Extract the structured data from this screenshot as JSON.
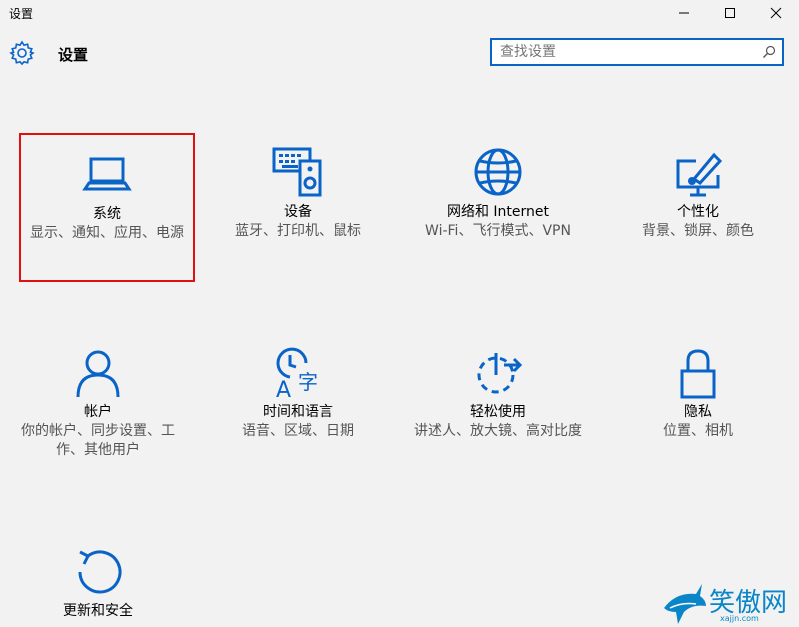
{
  "window": {
    "title": "设置"
  },
  "header": {
    "title": "设置",
    "gear_icon": "gear-icon"
  },
  "search": {
    "placeholder": "查找设置",
    "icon": "search-icon"
  },
  "colors": {
    "accent": "#0a64c8",
    "selection_border": "#e01010",
    "background": "#f2f2f2"
  },
  "tiles": [
    {
      "name": "系统",
      "desc": "显示、通知、应用、电源",
      "icon": "laptop-icon",
      "selected": true
    },
    {
      "name": "设备",
      "desc": "蓝牙、打印机、鼠标",
      "icon": "keyboard-speaker-icon"
    },
    {
      "name": "网络和 Internet",
      "desc": "Wi-Fi、飞行模式、VPN",
      "icon": "globe-icon"
    },
    {
      "name": "个性化",
      "desc": "背景、锁屏、颜色",
      "icon": "paint-monitor-icon"
    },
    {
      "name": "帐户",
      "desc": "你的帐户、同步设置、工作、其他用户",
      "icon": "person-icon"
    },
    {
      "name": "时间和语言",
      "desc": "语音、区域、日期",
      "icon": "clock-language-icon"
    },
    {
      "name": "轻松使用",
      "desc": "讲述人、放大镜、高对比度",
      "icon": "ease-of-access-icon"
    },
    {
      "name": "隐私",
      "desc": "位置、相机",
      "icon": "lock-icon"
    },
    {
      "name": "更新和安全",
      "desc": "",
      "icon": "refresh-icon"
    }
  ],
  "watermark": {
    "text": "笑傲网",
    "sub": "xajjn.com"
  }
}
